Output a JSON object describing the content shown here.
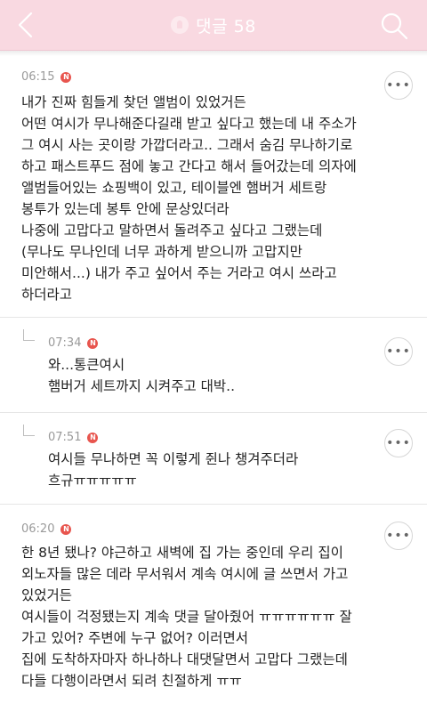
{
  "header": {
    "title": "댓글 58",
    "colors": {
      "bar": "#f9d9e1",
      "title": "#ffffff",
      "badge": "#e8554e"
    }
  },
  "comments": [
    {
      "time": "06:15",
      "badge": "N",
      "is_reply": false,
      "text": "내가 진짜 힘들게 찾던 앨범이 있었거든\n어떤 여시가 무나해준다길래 받고 싶다고 했는데 내 주소가\n그 여시 사는 곳이랑 가깝더라고.. 그래서 숨김 무나하기로\n하고 패스트푸드 점에 놓고 간다고 해서 들어갔는데 의자에\n앨범들어있는 쇼핑백이 있고, 테이블엔 햄버거 세트랑\n봉투가 있는데 봉투 안에 문상있더라\n나중에 고맙다고 말하면서 돌려주고 싶다고 그랬는데\n(무나도 무나인데 너무 과하게 받으니까 고맙지만\n미안해서...) 내가 주고 싶어서 주는 거라고 여시 쓰라고\n하더라고"
    },
    {
      "time": "07:34",
      "badge": "N",
      "is_reply": true,
      "text": "와...통큰여시\n햄버거 세트까지 시켜주고 대박.."
    },
    {
      "time": "07:51",
      "badge": "N",
      "is_reply": true,
      "text": "여시들 무나하면 꼭 이렇게 쥔나 챙겨주더라\n흐규ㅠㅠㅠㅠㅠ"
    },
    {
      "time": "06:20",
      "badge": "N",
      "is_reply": false,
      "text": "한 8년 됐나? 야근하고 새벽에 집 가는 중인데 우리 집이\n외노자들 많은 데라 무서워서 계속 여시에 글 쓰면서 가고\n있었거든\n여시들이 걱정됐는지 계속 댓글 달아줬어 ㅠㅠㅠㅠㅠㅠ 잘\n가고 있어? 주변에 누구 없어? 이러면서\n집에 도착하자마자 하나하나 대댓달면서 고맙다 그랬는데\n다들 다행이라면서 되려 친절하게 ㅠㅠ"
    }
  ]
}
